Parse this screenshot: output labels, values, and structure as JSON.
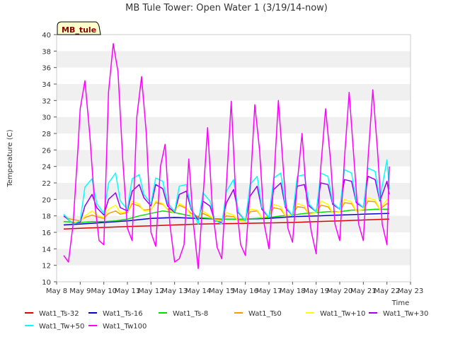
{
  "chart_data": {
    "type": "line",
    "title": "MB Tule Tower: Open Water 1 (3/19/14-now)",
    "xlabel": "Time",
    "ylabel": "Temperature (C)",
    "site_label": "MB_tule",
    "ylim": [
      10,
      40
    ],
    "yticks": [
      10,
      12,
      14,
      16,
      18,
      20,
      22,
      24,
      26,
      28,
      30,
      32,
      34,
      36,
      38,
      40
    ],
    "xlim": [
      8,
      23
    ],
    "xticks": [
      {
        "x": 8,
        "label": "May 8"
      },
      {
        "x": 9,
        "label": "May 9"
      },
      {
        "x": 10,
        "label": "May 10"
      },
      {
        "x": 11,
        "label": "May 11"
      },
      {
        "x": 12,
        "label": "May 12"
      },
      {
        "x": 13,
        "label": "May 13"
      },
      {
        "x": 14,
        "label": "May 14"
      },
      {
        "x": 15,
        "label": "May 15"
      },
      {
        "x": 16,
        "label": "May 16"
      },
      {
        "x": 17,
        "label": "May 17"
      },
      {
        "x": 18,
        "label": "May 18"
      },
      {
        "x": 19,
        "label": "May 19"
      },
      {
        "x": 20,
        "label": "May 20"
      },
      {
        "x": 21,
        "label": "May 21"
      },
      {
        "x": 22,
        "label": "May 22"
      },
      {
        "x": 23,
        "label": "May 23"
      }
    ],
    "grid": "horizontal bands",
    "legend_position": "bottom",
    "series": [
      {
        "name": "Wat1_Ts-32",
        "color": "#dd0000",
        "x": [
          8.3,
          9,
          10,
          11,
          12,
          13,
          14,
          15,
          16,
          17,
          18,
          19,
          20,
          21,
          22,
          22.1
        ],
        "y": [
          16.4,
          16.5,
          16.6,
          16.7,
          16.8,
          16.9,
          17.0,
          17.05,
          17.1,
          17.15,
          17.2,
          17.3,
          17.4,
          17.5,
          17.6,
          17.6
        ]
      },
      {
        "name": "Wat1_Ts-16",
        "color": "#0000cc",
        "x": [
          8.3,
          9,
          10,
          11,
          12,
          13,
          14,
          15,
          16,
          17,
          18,
          19,
          20,
          21,
          22,
          22.1
        ],
        "y": [
          16.9,
          17.0,
          17.2,
          17.4,
          17.7,
          17.8,
          17.7,
          17.6,
          17.6,
          17.7,
          17.9,
          18.0,
          18.1,
          18.2,
          18.3,
          18.3
        ]
      },
      {
        "name": "Wat1_Ts-8",
        "color": "#00dd00",
        "x": [
          8.3,
          9,
          9.5,
          10,
          10.5,
          11,
          11.5,
          12,
          12.5,
          13,
          13.5,
          14,
          14.5,
          15,
          15.5,
          16,
          16.5,
          17,
          17.5,
          18,
          18.5,
          19,
          19.5,
          20,
          20.5,
          21,
          21.5,
          22,
          22.1
        ],
        "y": [
          17.3,
          17.2,
          17.3,
          17.3,
          17.4,
          17.6,
          18.0,
          18.3,
          18.6,
          18.4,
          18.1,
          17.8,
          17.7,
          17.6,
          17.6,
          17.6,
          17.7,
          17.8,
          18.0,
          18.1,
          18.3,
          18.4,
          18.5,
          18.5,
          18.7,
          18.7,
          18.8,
          18.8,
          18.8
        ]
      },
      {
        "name": "Wat1_Ts0",
        "color": "#ff9900",
        "x": [
          8.3,
          8.6,
          9,
          9.2,
          9.5,
          9.7,
          10,
          10.2,
          10.5,
          10.7,
          11,
          11.2,
          11.5,
          11.7,
          12,
          12.2,
          12.5,
          12.7,
          13,
          13.2,
          13.5,
          13.7,
          14,
          14.2,
          14.5,
          14.7,
          15,
          15.2,
          15.5,
          15.7,
          16,
          16.2,
          16.5,
          16.7,
          17,
          17.2,
          17.5,
          17.7,
          18,
          18.2,
          18.5,
          18.7,
          19,
          19.2,
          19.5,
          19.7,
          20,
          20.2,
          20.5,
          20.7,
          21,
          21.2,
          21.5,
          21.7,
          22,
          22.1
        ],
        "y": [
          17.9,
          17.6,
          17.4,
          17.8,
          18.1,
          17.9,
          17.7,
          18.3,
          18.6,
          18.2,
          18.4,
          19.5,
          19.2,
          18.7,
          18.8,
          19.6,
          19.4,
          18.8,
          18.7,
          19.3,
          18.9,
          18.3,
          17.9,
          18.3,
          17.9,
          17.6,
          17.5,
          18.0,
          17.9,
          17.5,
          17.4,
          18.5,
          18.6,
          17.8,
          18.0,
          19.0,
          18.8,
          18.0,
          18.1,
          19.1,
          19.0,
          18.2,
          18.4,
          19.3,
          19.1,
          18.4,
          18.5,
          19.6,
          19.5,
          18.6,
          18.8,
          19.8,
          19.7,
          18.8,
          19.5,
          19.4
        ]
      },
      {
        "name": "Wat1_Tw+10",
        "color": "#ffff00",
        "x": [
          8.3,
          8.6,
          9,
          9.2,
          9.5,
          9.7,
          10,
          10.2,
          10.5,
          10.7,
          11,
          11.2,
          11.5,
          11.7,
          12,
          12.2,
          12.5,
          12.7,
          13,
          13.2,
          13.5,
          13.7,
          14,
          14.2,
          14.5,
          14.7,
          15,
          15.2,
          15.5,
          15.7,
          16,
          16.2,
          16.5,
          16.7,
          17,
          17.2,
          17.5,
          17.7,
          18,
          18.2,
          18.5,
          18.7,
          19,
          19.2,
          19.5,
          19.7,
          20,
          20.2,
          20.5,
          20.7,
          21,
          21.2,
          21.5,
          21.7,
          22,
          22.1
        ],
        "y": [
          18.0,
          17.3,
          17.2,
          18.0,
          18.6,
          18.1,
          17.8,
          18.8,
          19.3,
          18.4,
          18.5,
          19.8,
          19.4,
          18.6,
          18.7,
          19.8,
          19.5,
          18.7,
          18.4,
          19.5,
          19.0,
          18.0,
          17.7,
          18.6,
          18.0,
          17.5,
          17.3,
          18.4,
          18.1,
          17.4,
          17.3,
          18.8,
          18.7,
          17.8,
          18.0,
          19.4,
          19.1,
          18.0,
          18.1,
          19.5,
          19.2,
          18.2,
          18.4,
          19.8,
          19.4,
          18.4,
          18.5,
          20.0,
          19.7,
          18.6,
          18.8,
          20.2,
          19.9,
          18.8,
          20.0,
          19.8
        ]
      },
      {
        "name": "Wat1_Tw+30",
        "color": "#9900ee",
        "x": [
          8.3,
          8.7,
          9,
          9.2,
          9.5,
          9.7,
          10,
          10.2,
          10.5,
          10.7,
          11,
          11.2,
          11.5,
          11.7,
          12,
          12.2,
          12.5,
          12.7,
          13,
          13.2,
          13.5,
          13.7,
          14,
          14.2,
          14.5,
          14.7,
          15,
          15.2,
          15.5,
          15.7,
          16,
          16.2,
          16.5,
          16.7,
          17,
          17.2,
          17.5,
          17.7,
          18,
          18.2,
          18.5,
          18.7,
          19,
          19.2,
          19.5,
          19.7,
          20,
          20.2,
          20.5,
          20.7,
          21,
          21.2,
          21.5,
          21.7,
          22,
          22.1
        ],
        "y": [
          18.0,
          17.1,
          17.2,
          19.2,
          20.6,
          19.0,
          18.1,
          20.0,
          20.8,
          19.0,
          18.6,
          21.0,
          21.8,
          20.2,
          19.2,
          21.8,
          21.3,
          19.2,
          18.4,
          20.6,
          21.0,
          18.8,
          17.5,
          19.8,
          19.2,
          17.4,
          17.2,
          19.6,
          21.2,
          18.4,
          17.4,
          20.4,
          21.6,
          18.8,
          17.8,
          21.2,
          22.0,
          19.0,
          18.0,
          21.6,
          21.8,
          19.2,
          18.5,
          22.0,
          21.8,
          19.4,
          18.8,
          22.4,
          22.2,
          19.6,
          19.0,
          22.8,
          22.4,
          19.8,
          22.2,
          20.6
        ]
      },
      {
        "name": "Wat1_Tw+50",
        "color": "#00ffff",
        "x": [
          8.3,
          8.7,
          9,
          9.2,
          9.5,
          9.7,
          10,
          10.2,
          10.5,
          10.7,
          11,
          11.2,
          11.5,
          11.7,
          12,
          12.2,
          12.5,
          12.7,
          13,
          13.2,
          13.5,
          13.7,
          14,
          14.2,
          14.5,
          14.7,
          15,
          15.2,
          15.5,
          15.7,
          16,
          16.2,
          16.5,
          16.7,
          17,
          17.2,
          17.5,
          17.7,
          18,
          18.2,
          18.5,
          18.7,
          19,
          19.2,
          19.5,
          19.7,
          20,
          20.2,
          20.5,
          20.7,
          21,
          21.2,
          21.5,
          21.7,
          22,
          22.1
        ],
        "y": [
          18.2,
          17.0,
          17.4,
          21.5,
          22.5,
          19.5,
          18.3,
          22.0,
          23.2,
          19.8,
          18.8,
          22.5,
          23.0,
          20.6,
          19.5,
          22.6,
          22.2,
          19.6,
          18.5,
          21.6,
          21.8,
          19.0,
          17.0,
          20.8,
          19.8,
          17.5,
          17.0,
          21.0,
          22.4,
          18.5,
          17.4,
          21.8,
          22.8,
          19.0,
          17.8,
          22.6,
          23.2,
          19.2,
          18.0,
          22.8,
          23.0,
          19.4,
          18.5,
          23.2,
          22.8,
          19.6,
          18.8,
          23.6,
          23.2,
          19.8,
          19.0,
          23.8,
          23.4,
          20.0,
          24.8,
          21.2
        ]
      },
      {
        "name": "Wat1_Tw100",
        "color": "#ff00ff",
        "x": [
          8.3,
          8.5,
          8.7,
          8.9,
          9.0,
          9.2,
          9.4,
          9.6,
          9.8,
          10.0,
          10.2,
          10.4,
          10.6,
          10.8,
          11.0,
          11.2,
          11.4,
          11.6,
          11.8,
          12.0,
          12.2,
          12.4,
          12.6,
          12.8,
          13.0,
          13.2,
          13.4,
          13.6,
          13.8,
          14.0,
          14.2,
          14.4,
          14.6,
          14.8,
          15.0,
          15.2,
          15.4,
          15.6,
          15.8,
          16.0,
          16.2,
          16.4,
          16.6,
          16.8,
          17.0,
          17.2,
          17.4,
          17.6,
          17.8,
          18.0,
          18.2,
          18.4,
          18.6,
          18.8,
          19.0,
          19.2,
          19.4,
          19.6,
          19.8,
          20.0,
          20.2,
          20.4,
          20.6,
          20.8,
          21.0,
          21.2,
          21.4,
          21.6,
          21.8,
          22.0,
          22.1
        ],
        "y": [
          13.2,
          12.4,
          17.0,
          26.0,
          31.0,
          34.4,
          28.0,
          20.0,
          15.0,
          14.5,
          33.0,
          38.9,
          35.5,
          25.0,
          16.5,
          15.0,
          30.0,
          34.9,
          28.0,
          16.0,
          14.3,
          24.0,
          26.7,
          17.0,
          12.4,
          12.8,
          14.5,
          24.9,
          17.0,
          11.6,
          20.0,
          28.7,
          19.0,
          14.2,
          12.8,
          22.0,
          31.9,
          20.0,
          14.5,
          13.2,
          21.0,
          31.5,
          26.0,
          17.0,
          14.0,
          22.0,
          32.0,
          24.0,
          16.5,
          14.8,
          22.0,
          28.0,
          20.0,
          16.0,
          13.4,
          24.0,
          31.0,
          25.0,
          17.0,
          15.0,
          25.0,
          33.0,
          25.0,
          17.0,
          15.0,
          25.0,
          33.3,
          26.0,
          17.0,
          14.5,
          24.0
        ]
      }
    ]
  }
}
